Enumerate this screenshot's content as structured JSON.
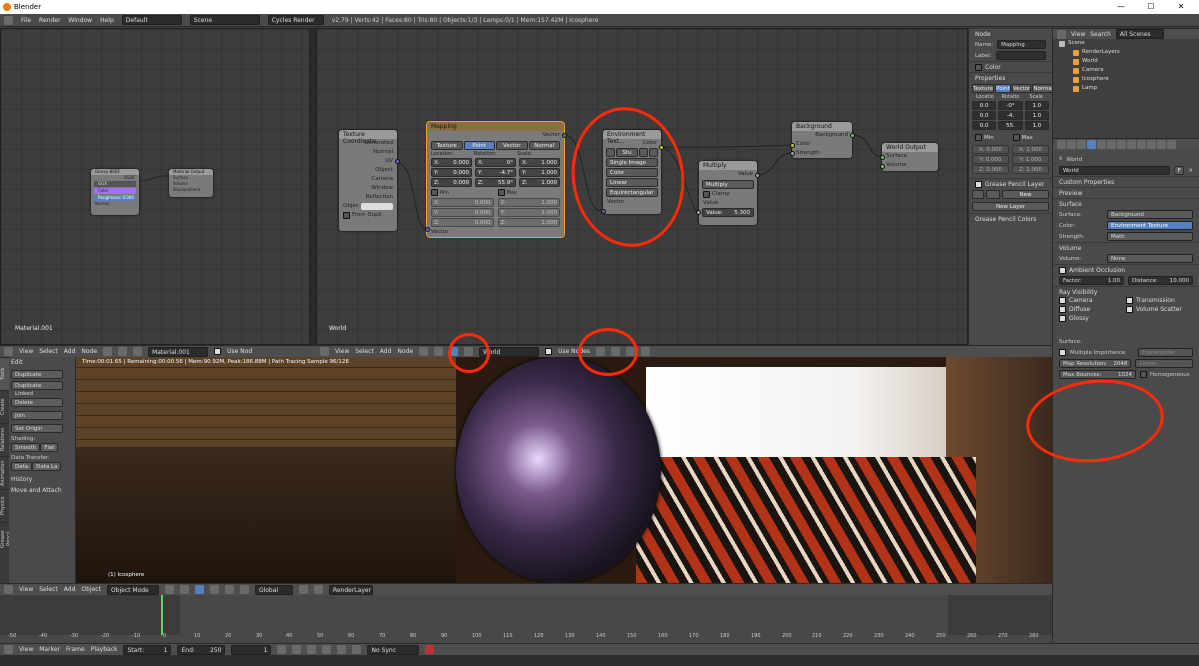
{
  "window": {
    "title": "Blender",
    "controls": [
      "—",
      "☐",
      "✕"
    ]
  },
  "infobar": {
    "menus": [
      "File",
      "Render",
      "Window",
      "Help"
    ],
    "layout": "Default",
    "scene": "Scene",
    "engine": "Cycles Render",
    "stats": "v2.79 | Verts:42 | Faces:80 | Tris:80 | Objects:1/3 | Lamps:0/1 | Mem:157.42M | Icosphere"
  },
  "left_node_editor": {
    "label": "Material.001",
    "node_a": {
      "title": "Glossy BSDF",
      "rows": [
        "BSDF",
        "GGX",
        "Color",
        "Roughness: 0.000",
        "Normal"
      ]
    },
    "node_b": {
      "title": "Material Output",
      "rows": [
        "Surface",
        "Volume",
        "Displacement"
      ]
    }
  },
  "world_node_editor": {
    "label": "World",
    "texture_coordinate": {
      "title": "Texture Coordinate",
      "outputs": [
        "Generated",
        "Normal",
        "UV",
        "Object",
        "Camera",
        "Window",
        "Reflection"
      ],
      "object_label": "Objec",
      "from_dupli": "From Dupli"
    },
    "mapping": {
      "title": "Mapping",
      "output": "Vector",
      "tabs": [
        "Texture",
        "Point",
        "Vector",
        "Normal"
      ],
      "col_heads": [
        "Location:",
        "Rotation:",
        "Scale:"
      ],
      "rows": [
        [
          "X:",
          "0.000",
          "X:",
          "0°",
          "X:",
          "1.000"
        ],
        [
          "Y:",
          "0.000",
          "Y:",
          "-4.7°",
          "Y:",
          "1.000"
        ],
        [
          "Z:",
          "0.000",
          "Z:",
          "55.9°",
          "Z:",
          "1.000"
        ]
      ],
      "min": "Min",
      "max": "Max",
      "min_rows": [
        [
          "X:",
          "0.000",
          "X:",
          "1.000"
        ],
        [
          "Y:",
          "0.000",
          "Y:",
          "1.000"
        ],
        [
          "Z:",
          "0.000",
          "Z:",
          "1.000"
        ]
      ],
      "input": "Vector"
    },
    "environment": {
      "title": "Environment Text...",
      "output": "Color",
      "open": "Stu",
      "options": [
        "Single Image",
        "Color",
        "Linear",
        "Equirectangular"
      ],
      "input": "Vector"
    },
    "multiply": {
      "title": "Multiply",
      "output": "Value",
      "op": "Multiply",
      "clamp": "Clamp",
      "input_label": "Value",
      "value": "5.300",
      "value_label": "Value:"
    },
    "background": {
      "title": "Background",
      "output": "Background",
      "inputs": [
        "Color",
        "Strength"
      ]
    },
    "world_output": {
      "title": "World Output",
      "inputs": [
        "Surface",
        "Volume"
      ]
    }
  },
  "node_sidebar": {
    "node_title": "Node",
    "name_label": "Name:",
    "name": "Mapping",
    "label_label": "Label:",
    "color_title": "Color",
    "props_title": "Properties",
    "tabs": [
      "Texture",
      "Point",
      "Vector",
      "Normal"
    ],
    "heads": [
      "Locatio",
      "Rotatio",
      "Scale"
    ],
    "rows": [
      [
        "0.0",
        "-0°",
        "1.0"
      ],
      [
        "0.0",
        "-4.",
        "1.0"
      ],
      [
        "0.0",
        "55.",
        "1.0"
      ]
    ],
    "min": "Min",
    "max": "Max",
    "min_rows": [
      [
        "X: 0.000",
        "X: 1.000"
      ],
      [
        "Y: 0.000",
        "Y: 1.000"
      ],
      [
        "Z: 0.000",
        "Z: 1.000"
      ]
    ],
    "gp_layer": "Grease Pencil Layer",
    "new": "New",
    "new_layer": "New Layer",
    "gp_colors": "Grease Pencil Colors"
  },
  "node_header_left": {
    "menus": [
      "View",
      "Select",
      "Add",
      "Node"
    ],
    "material": "Material.001",
    "use_nodes": "Use Nod"
  },
  "node_header_right": {
    "menus": [
      "View",
      "Select",
      "Add",
      "Node"
    ],
    "world": "World",
    "use_nodes": "Use Nodes"
  },
  "outliner": {
    "menus": [
      "View",
      "Search"
    ],
    "filter": "All Scenes",
    "items": [
      {
        "label": "Scene",
        "depth": 0
      },
      {
        "label": "RenderLayers",
        "depth": 1
      },
      {
        "label": "World",
        "depth": 1
      },
      {
        "label": "Camera",
        "depth": 1
      },
      {
        "label": "Icosphere",
        "depth": 1
      },
      {
        "label": "Lamp",
        "depth": 1
      }
    ]
  },
  "properties": {
    "crumb": "World",
    "world_name": "World",
    "f": "F",
    "panels": {
      "custom": "Custom Properties",
      "preview": "Preview",
      "surface": "Surface",
      "surface_label": "Surface:",
      "surface_val": "Background",
      "color_label": "Color:",
      "color_val": "Environment Texture",
      "strength_label": "Strength:",
      "strength_val": "Math",
      "volume": "Volume",
      "volume_label": "Volume:",
      "volume_val": "None",
      "ao": "Ambient Occlusion",
      "factor": "Factor:",
      "factor_val": "1.00",
      "distance": "Distance:",
      "distance_val": "10.000",
      "ray": "Ray Visibility",
      "checks": [
        "Camera",
        "Transmission",
        "Diffuse",
        "Volume Scatter",
        "Glossy"
      ],
      "settings_surface": "Surface:",
      "mis": "Multiple Importance",
      "equi": "Equiangular",
      "linear": "Linear",
      "map_res": "Map Resolution:",
      "map_res_val": "2048",
      "max_bounce": "Max Bounces:",
      "max_bounce_val": "1024",
      "homog": "Homogeneous"
    }
  },
  "tool_shelf": {
    "edit": "Edit",
    "buttons": [
      "Duplicate",
      "Duplicate Linked",
      "Delete"
    ],
    "join": "Join",
    "set_origin": "Set Origin",
    "shading": "Shading:",
    "smooth": "Smooth",
    "flat": "Flat",
    "data_transfer": "Data Transfer:",
    "data": "Data",
    "data_la": "Data La",
    "history": "History",
    "move_attach": "Move and Attach",
    "tabs": [
      "Tools",
      "Create",
      "Relations",
      "Animation",
      "Physics",
      "Grease Pencil"
    ]
  },
  "viewport": {
    "render_info": "Time:00:01.65 | Remaining:00:00.56 | Mem:90.92M, Peak:186.88M | Path Tracing Sample 96/128",
    "object_label": "(1) Icosphere"
  },
  "view3d_header": {
    "menus": [
      "View",
      "Select",
      "Add",
      "Object"
    ],
    "mode": "Object Mode",
    "orient": "Global",
    "layer": "RenderLayer"
  },
  "timeline": {
    "ticks": [
      "-50",
      "-40",
      "-30",
      "-20",
      "-10",
      "0",
      "10",
      "20",
      "30",
      "40",
      "50",
      "60",
      "70",
      "80",
      "90",
      "100",
      "110",
      "120",
      "130",
      "140",
      "150",
      "160",
      "170",
      "180",
      "190",
      "200",
      "210",
      "220",
      "230",
      "240",
      "250",
      "260",
      "270",
      "280"
    ],
    "current_frame_fraction": 0.1526
  },
  "timeline_header": {
    "menus": [
      "View",
      "Marker",
      "Frame",
      "Playback"
    ],
    "start_label": "Start:",
    "start": "1",
    "end_label": "End:",
    "end": "250",
    "frame": "1",
    "sync": "No Sync"
  },
  "colors": {
    "annotation": "#ff2a0a",
    "selected": "#5680c2",
    "socket_vector": "#6363c7",
    "socket_color": "#c7c729",
    "socket_shader": "#63c763",
    "socket_value": "#a1a1a1"
  }
}
